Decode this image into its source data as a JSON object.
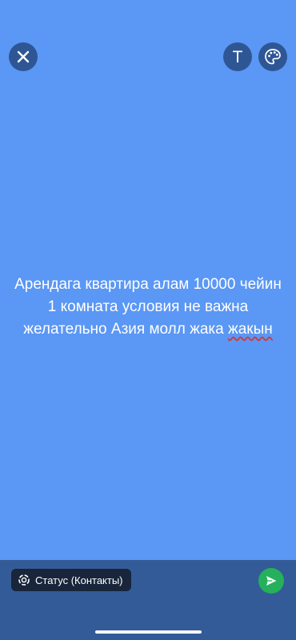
{
  "header": {
    "close_icon": "close-icon",
    "text_tool_label": "T",
    "palette_icon": "palette-icon"
  },
  "status": {
    "text_part1": "Арендага квартира алам 10000 чейин 1 комната условия не важна желательно Азия молл жака ",
    "text_underlined": "жакын",
    "background_color": "#5b97f4"
  },
  "footer": {
    "privacy_label": "Статус (Контакты)",
    "privacy_icon": "status-ring-icon",
    "send_icon": "send-icon",
    "send_color": "#25b05c"
  }
}
